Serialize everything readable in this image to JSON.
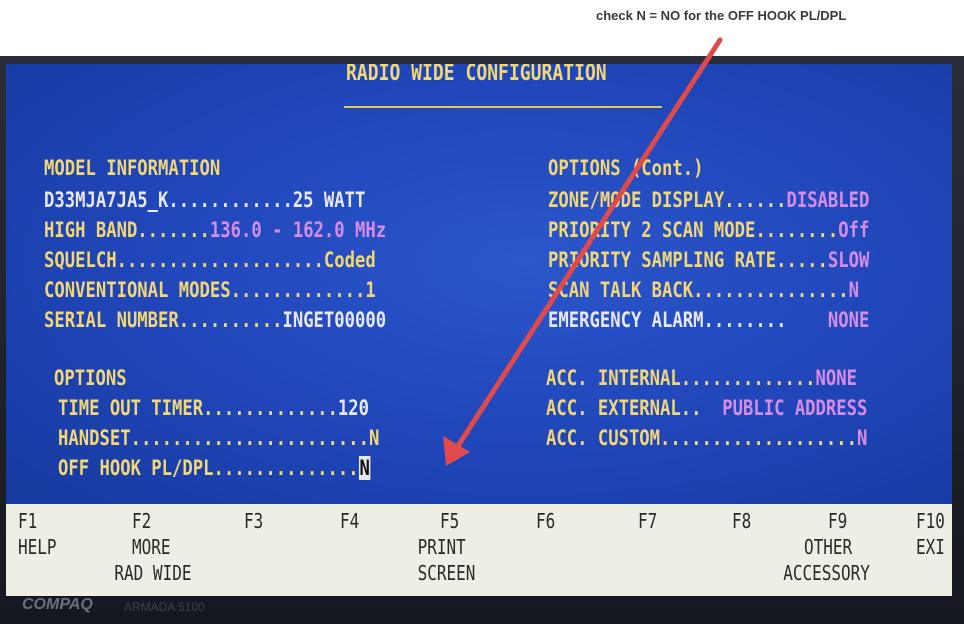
{
  "annotation": "check N = NO for the OFF HOOK PL/DPL",
  "screen": {
    "title": "RADIO WIDE CONFIGURATION",
    "model_info": {
      "heading": "MODEL INFORMATION",
      "rows": [
        {
          "label": "D33MJA7JA5_K............",
          "value": "25 WATT"
        },
        {
          "label": "HIGH BAND.......",
          "value": "136.0 - 162.0 MHz"
        },
        {
          "label": "SQUELCH....................",
          "value": "Coded"
        },
        {
          "label": "CONVENTIONAL MODES.............",
          "value": "1"
        },
        {
          "label": "SERIAL NUMBER..........",
          "value": "INGET00000"
        }
      ]
    },
    "options": {
      "heading": "OPTIONS",
      "rows": [
        {
          "label": "TIME OUT TIMER.............",
          "value": "120"
        },
        {
          "label": "HANDSET.......................",
          "value": "N"
        },
        {
          "label": "OFF HOOK PL/DPL..............",
          "value": "N"
        }
      ]
    },
    "options_cont": {
      "heading": "OPTIONS (Cont.)",
      "rows": [
        {
          "label": "ZONE/MODE DISPLAY......",
          "value": "DISABLED"
        },
        {
          "label": "PRIORITY 2 SCAN MODE........",
          "value": "Off"
        },
        {
          "label": "PRIORITY SAMPLING RATE.....",
          "value": "SLOW"
        },
        {
          "label": "SCAN TALK BACK...............",
          "value": "N"
        },
        {
          "label": "EMERGENCY ALARM........    ",
          "value": "NONE"
        }
      ]
    },
    "accessories": {
      "rows": [
        {
          "label": "ACC. INTERNAL.............",
          "value": "NONE"
        },
        {
          "label": "ACC. EXTERNAL..  ",
          "value": "PUBLIC ADDRESS"
        },
        {
          "label": "ACC. CUSTOM...................",
          "value": "N"
        }
      ]
    }
  },
  "function_keys": [
    {
      "key": "F1",
      "line1": "HELP",
      "line2": ""
    },
    {
      "key": "F2",
      "line1": "MORE",
      "line2": "RAD WIDE"
    },
    {
      "key": "F3",
      "line1": "",
      "line2": ""
    },
    {
      "key": "F4",
      "line1": "",
      "line2": ""
    },
    {
      "key": "F5",
      "line1": "PRINT",
      "line2": "SCREEN"
    },
    {
      "key": "F6",
      "line1": "",
      "line2": ""
    },
    {
      "key": "F7",
      "line1": "",
      "line2": ""
    },
    {
      "key": "F8",
      "line1": "",
      "line2": ""
    },
    {
      "key": "F9",
      "line1": "OTHER",
      "line2": "ACCESSORY"
    },
    {
      "key": "F10",
      "line1": "EXI",
      "line2": ""
    }
  ],
  "brand": "COMPAQ",
  "model_mark": "ARMADA 5100",
  "colors": {
    "screen": "#1f45b8",
    "heading": "#f2d774",
    "text": "#e7e8f0",
    "value_alt": "#d78ce6",
    "arrow": "#e04a4a"
  }
}
